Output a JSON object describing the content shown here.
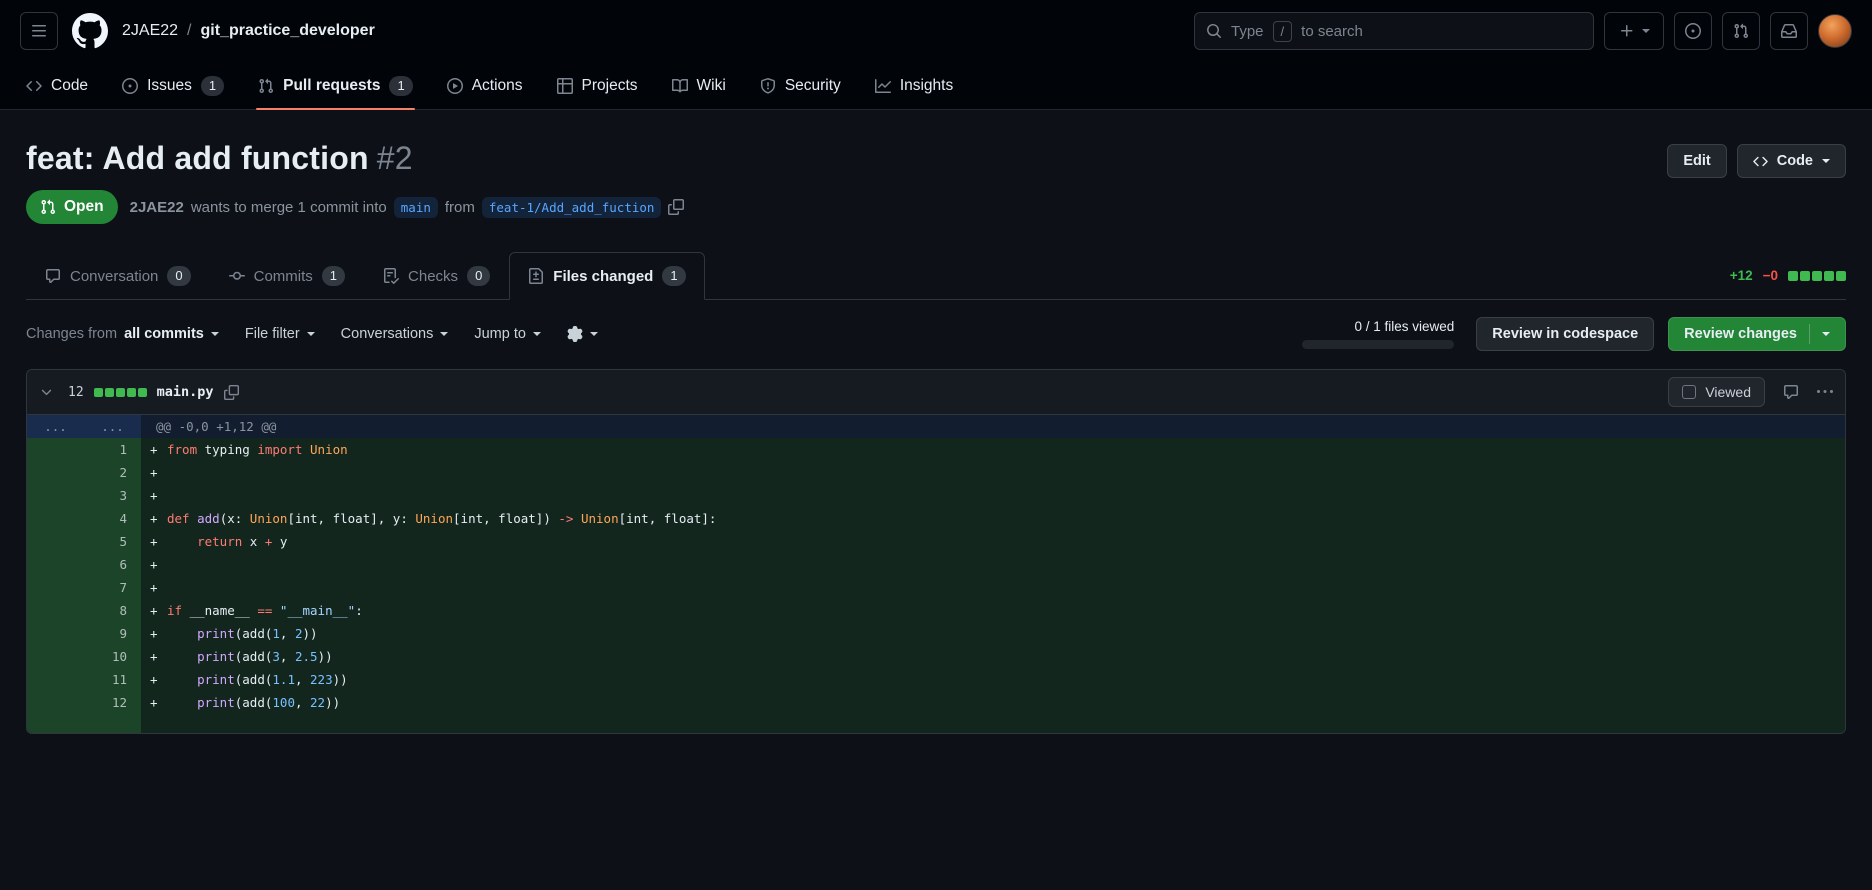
{
  "header": {
    "owner": "2JAE22",
    "separator": "/",
    "repo": "git_practice_developer",
    "search": {
      "prefix": "Type",
      "key": "/",
      "suffix": "to search"
    }
  },
  "nav": {
    "items": [
      {
        "label": "Code"
      },
      {
        "label": "Issues",
        "count": "1"
      },
      {
        "label": "Pull requests",
        "count": "1"
      },
      {
        "label": "Actions"
      },
      {
        "label": "Projects"
      },
      {
        "label": "Wiki"
      },
      {
        "label": "Security"
      },
      {
        "label": "Insights"
      }
    ]
  },
  "pr": {
    "title": "feat: Add add function",
    "number": "#2",
    "edit_label": "Edit",
    "code_label": "Code",
    "state": "Open",
    "author": "2JAE22",
    "merge_text_1": "wants to merge 1 commit into",
    "base_branch": "main",
    "merge_text_2": "from",
    "head_branch": "feat-1/Add_add_fuction"
  },
  "tabs": {
    "items": [
      {
        "label": "Conversation",
        "count": "0"
      },
      {
        "label": "Commits",
        "count": "1"
      },
      {
        "label": "Checks",
        "count": "0"
      },
      {
        "label": "Files changed",
        "count": "1"
      }
    ]
  },
  "diffstat": {
    "additions": "+12",
    "deletions": "−0",
    "blocks": [
      "add",
      "add",
      "add",
      "add",
      "add"
    ]
  },
  "toolbar": {
    "changes_from": "Changes from",
    "all_commits": "all commits",
    "file_filter": "File filter",
    "conversations": "Conversations",
    "jump_to": "Jump to",
    "files_viewed": "0 / 1 files viewed",
    "review_codespace": "Review in codespace",
    "review_changes": "Review changes"
  },
  "file": {
    "stat": "12",
    "blocks": [
      "add",
      "add",
      "add",
      "add",
      "add"
    ],
    "name": "main.py",
    "viewed": "Viewed",
    "hunk": {
      "gutter": "...",
      "text": "@@ -0,0 +1,12 @@"
    }
  },
  "diff": {
    "lines": [
      {
        "num": "1",
        "tokens": [
          [
            "k",
            "from"
          ],
          [
            "p",
            " typing "
          ],
          [
            "k",
            "import"
          ],
          [
            "p",
            " "
          ],
          [
            "e",
            "Union"
          ]
        ]
      },
      {
        "num": "2",
        "tokens": []
      },
      {
        "num": "3",
        "tokens": []
      },
      {
        "num": "4",
        "tokens": [
          [
            "k",
            "def"
          ],
          [
            "p",
            " "
          ],
          [
            "f",
            "add"
          ],
          [
            "p",
            "(x: "
          ],
          [
            "e",
            "Union"
          ],
          [
            "p",
            "[int, float], y: "
          ],
          [
            "e",
            "Union"
          ],
          [
            "p",
            "[int, float]) "
          ],
          [
            "k",
            "->"
          ],
          [
            "p",
            " "
          ],
          [
            "e",
            "Union"
          ],
          [
            "p",
            "[int, float]:"
          ]
        ]
      },
      {
        "num": "5",
        "tokens": [
          [
            "p",
            "    "
          ],
          [
            "k",
            "return"
          ],
          [
            "p",
            " x "
          ],
          [
            "k",
            "+"
          ],
          [
            "p",
            " y"
          ]
        ]
      },
      {
        "num": "6",
        "tokens": []
      },
      {
        "num": "7",
        "tokens": []
      },
      {
        "num": "8",
        "tokens": [
          [
            "k",
            "if"
          ],
          [
            "p",
            " __name__ "
          ],
          [
            "k",
            "=="
          ],
          [
            "p",
            " "
          ],
          [
            "s",
            "\"__main__\""
          ],
          [
            "p",
            ":"
          ]
        ]
      },
      {
        "num": "9",
        "tokens": [
          [
            "p",
            "    "
          ],
          [
            "f",
            "print"
          ],
          [
            "p",
            "(add("
          ],
          [
            "n",
            "1"
          ],
          [
            "p",
            ", "
          ],
          [
            "n",
            "2"
          ],
          [
            "p",
            "))"
          ]
        ]
      },
      {
        "num": "10",
        "tokens": [
          [
            "p",
            "    "
          ],
          [
            "f",
            "print"
          ],
          [
            "p",
            "(add("
          ],
          [
            "n",
            "3"
          ],
          [
            "p",
            ", "
          ],
          [
            "n",
            "2.5"
          ],
          [
            "p",
            "))"
          ]
        ]
      },
      {
        "num": "11",
        "tokens": [
          [
            "p",
            "    "
          ],
          [
            "f",
            "print"
          ],
          [
            "p",
            "(add("
          ],
          [
            "n",
            "1.1"
          ],
          [
            "p",
            ", "
          ],
          [
            "n",
            "223"
          ],
          [
            "p",
            "))"
          ]
        ]
      },
      {
        "num": "12",
        "tokens": [
          [
            "p",
            "    "
          ],
          [
            "f",
            "print"
          ],
          [
            "p",
            "(add("
          ],
          [
            "n",
            "100"
          ],
          [
            "p",
            ", "
          ],
          [
            "n",
            "22"
          ],
          [
            "p",
            "))"
          ]
        ]
      }
    ]
  }
}
